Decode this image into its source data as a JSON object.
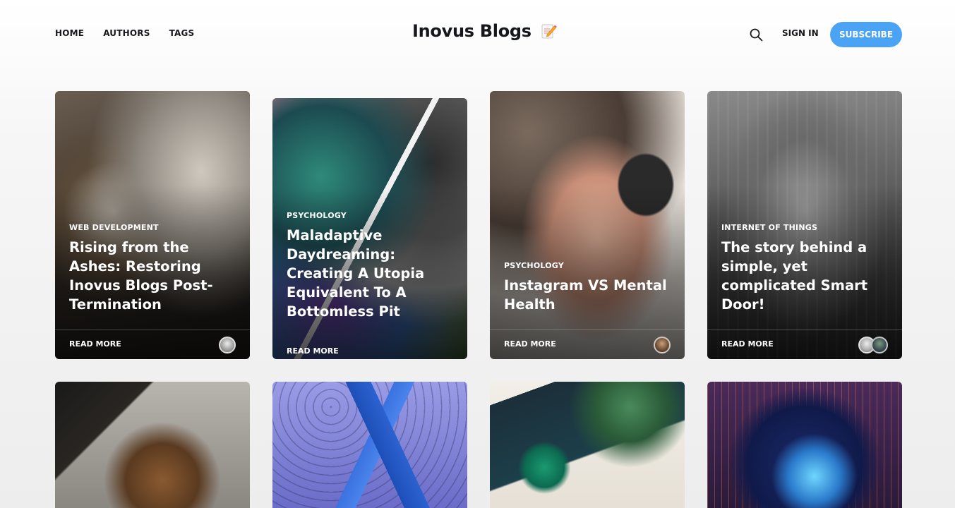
{
  "nav": {
    "links": [
      "HOME",
      "AUTHORS",
      "TAGS"
    ],
    "logo_text": "Inovus Blogs",
    "signin": "SIGN IN",
    "subscribe": "SUBSCRIBE",
    "search_icon": "search-icon",
    "logo_icon": "memo-icon"
  },
  "colors": {
    "accent": "#4aa3f5",
    "text": "#15171a"
  },
  "posts": [
    {
      "tag": "WEB DEVELOPMENT",
      "title": "Rising from the Ashes: Restoring Inovus Blogs Post-Termination",
      "read_more": "READ MORE"
    },
    {
      "tag": "PSYCHOLOGY",
      "title": "Maladaptive Daydreaming: Creating A Utopia Equivalent To A Bottomless Pit",
      "read_more": "READ MORE"
    },
    {
      "tag": "PSYCHOLOGY",
      "title": "Instagram VS Mental Health",
      "read_more": "READ MORE"
    },
    {
      "tag": "INTERNET OF THINGS",
      "title": "The story behind a simple, yet complicated Smart Door!",
      "read_more": "READ MORE"
    }
  ]
}
